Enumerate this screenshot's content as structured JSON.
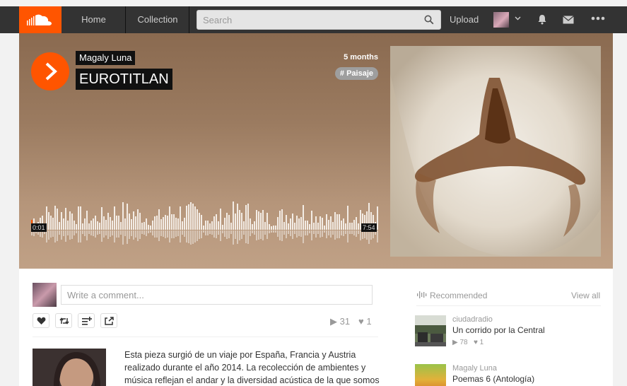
{
  "nav": {
    "home": "Home",
    "collection": "Collection",
    "search_placeholder": "Search",
    "upload": "Upload"
  },
  "track": {
    "artist": "Magaly Luna",
    "title": "EUROTITLAN",
    "age": "5 months",
    "tag": "# Paisaje",
    "time_current": "0:01",
    "time_total": "7:54"
  },
  "comment": {
    "placeholder": "Write a comment..."
  },
  "stats": {
    "plays": "31",
    "likes": "1"
  },
  "description": "Esta pieza surgió de un viaje por España, Francia y Austria realizado durante el año 2014. La recolección de ambientes y música reflejan el andar y la diversidad acústica de la que somos",
  "recommended": {
    "heading": "Recommended",
    "view_all": "View all",
    "items": [
      {
        "user": "ciudadradio",
        "title": "Un corrido por la Central",
        "plays": "78",
        "likes": "1"
      },
      {
        "user": "Magaly Luna",
        "title": "Poemas 6 (Antología)"
      }
    ]
  },
  "colors": {
    "accent": "#ff5500",
    "topbar": "#333333"
  },
  "icons": [
    "soundcloud-logo-icon",
    "search-icon",
    "chevron-down-icon",
    "bell-icon",
    "mail-icon",
    "more-icon",
    "play-icon",
    "heart-icon",
    "repost-icon",
    "add-to-playlist-icon",
    "share-icon",
    "recommended-icon"
  ]
}
